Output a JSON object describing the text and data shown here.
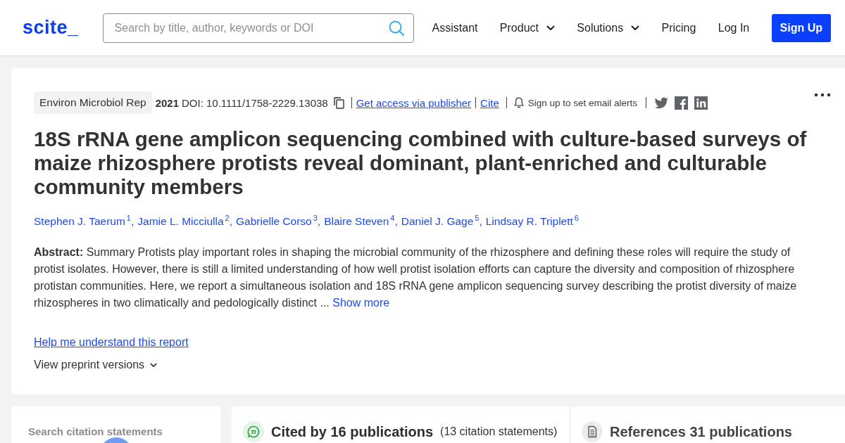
{
  "header": {
    "logo": "scite_",
    "search": {
      "placeholder": "Search by title, author, keywords or DOI"
    },
    "nav": [
      {
        "label": "Assistant",
        "kind": "link"
      },
      {
        "label": "Product",
        "kind": "dropdown"
      },
      {
        "label": "Solutions",
        "kind": "dropdown"
      },
      {
        "label": "Pricing",
        "kind": "link"
      },
      {
        "label": "Log In",
        "kind": "link"
      },
      {
        "label": "Sign Up",
        "kind": "button"
      }
    ]
  },
  "article": {
    "journal": "Environ Microbiol Rep",
    "year": "2021",
    "doi": "DOI: 10.1111/1758-2229.13038",
    "access_link": "Get access via publisher",
    "cite_link": "Cite",
    "alerts": "Sign up to set email alerts",
    "title": "18S rRNA gene amplicon sequencing combined with culture-based surveys of maize rhizosphere protists reveal dominant, plant-enriched and culturable community members",
    "authors": [
      {
        "name": "Stephen J. Taerum",
        "affiliation": "1",
        "separator": ","
      },
      {
        "name": "Jamie L. Micciulla",
        "affiliation": "2",
        "separator": ","
      },
      {
        "name": "Gabrielle Corso",
        "affiliation": "3",
        "separator": ","
      },
      {
        "name": "Blaire Steven",
        "affiliation": "4",
        "separator": ","
      },
      {
        "name": "Daniel J. Gage",
        "affiliation": "5",
        "separator": ","
      },
      {
        "name": "Lindsay R. Triplett",
        "affiliation": "6"
      }
    ],
    "abstract": "**Abstract:** Summary Protists play important roles in shaping the microbial community of the rhizosphere and defining these roles will require the study of protist isolates. However, there is still a limited understanding of how well protist isolation efforts can capture the diversity and composition of rhizosphere protistan communities. Here, we report a simultaneous isolation and 18S rRNA gene amplicon sequencing survey describing the protist diversity of maize rhizospheres in two climatically and pedologically distinct ...",
    "show_more": "Show more",
    "help_link": "Help me understand this report",
    "preprint_toggle": "View preprint versions"
  },
  "citation_search": {
    "label": "Search citation statements"
  },
  "citations": [
    {
      "kind": "cited_by",
      "title": "Cited by 16 publications",
      "note": "(13 citation statements)"
    },
    {
      "kind": "references",
      "title": "References 31 publications"
    }
  ]
}
